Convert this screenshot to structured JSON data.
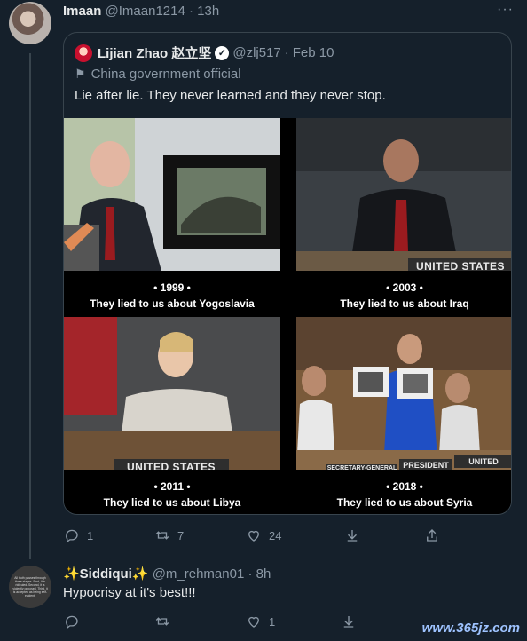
{
  "tweet1": {
    "display_name": "Imaan",
    "handle": "@Imaan1214",
    "separator": "·",
    "time": "13h",
    "more_icon": "more-horizontal-icon",
    "quote": {
      "display_name": "Lijian Zhao 赵立坚",
      "verified_icon": "verified-badge-icon",
      "handle": "@zlj517",
      "date": "Feb 10",
      "label": "China government official",
      "text": "Lie after lie. They never learned and they never stop.",
      "panels": [
        {
          "year": "• 1999 •",
          "line": "They lied to us about Yogoslavia"
        },
        {
          "year": "• 2003 •",
          "line": "They lied to us about Iraq",
          "sign": "UNITED STATES"
        },
        {
          "year": "• 2011 •",
          "line": "They lied to us about Libya",
          "sign": "UNITED STATES"
        },
        {
          "year": "• 2018 •",
          "line": "They lied to us about Syria",
          "sign": "PRESIDENT",
          "sign2": "UNITED STATES",
          "sign3": "SECRETARY-GENERAL"
        }
      ]
    },
    "actions": {
      "reply": "1",
      "retweet": "7",
      "like": "24"
    }
  },
  "tweet2": {
    "display_name": "✨Siddiqui✨",
    "handle": "@m_rehman01",
    "separator": "·",
    "time": "8h",
    "text": "Hypocrisy at it's best!!!",
    "avatar_text": "All truth passes through three stages. First, it is ridiculed. Second, it is violently opposed. Third, it is accepted as being self-evident.",
    "actions": {
      "reply": "",
      "retweet": "",
      "like": "1"
    }
  },
  "watermark": "www.365jz.com",
  "colors": {
    "background": "#15202b",
    "border": "#38444d",
    "muted": "#8b98a5",
    "text": "#e7e9ea"
  }
}
